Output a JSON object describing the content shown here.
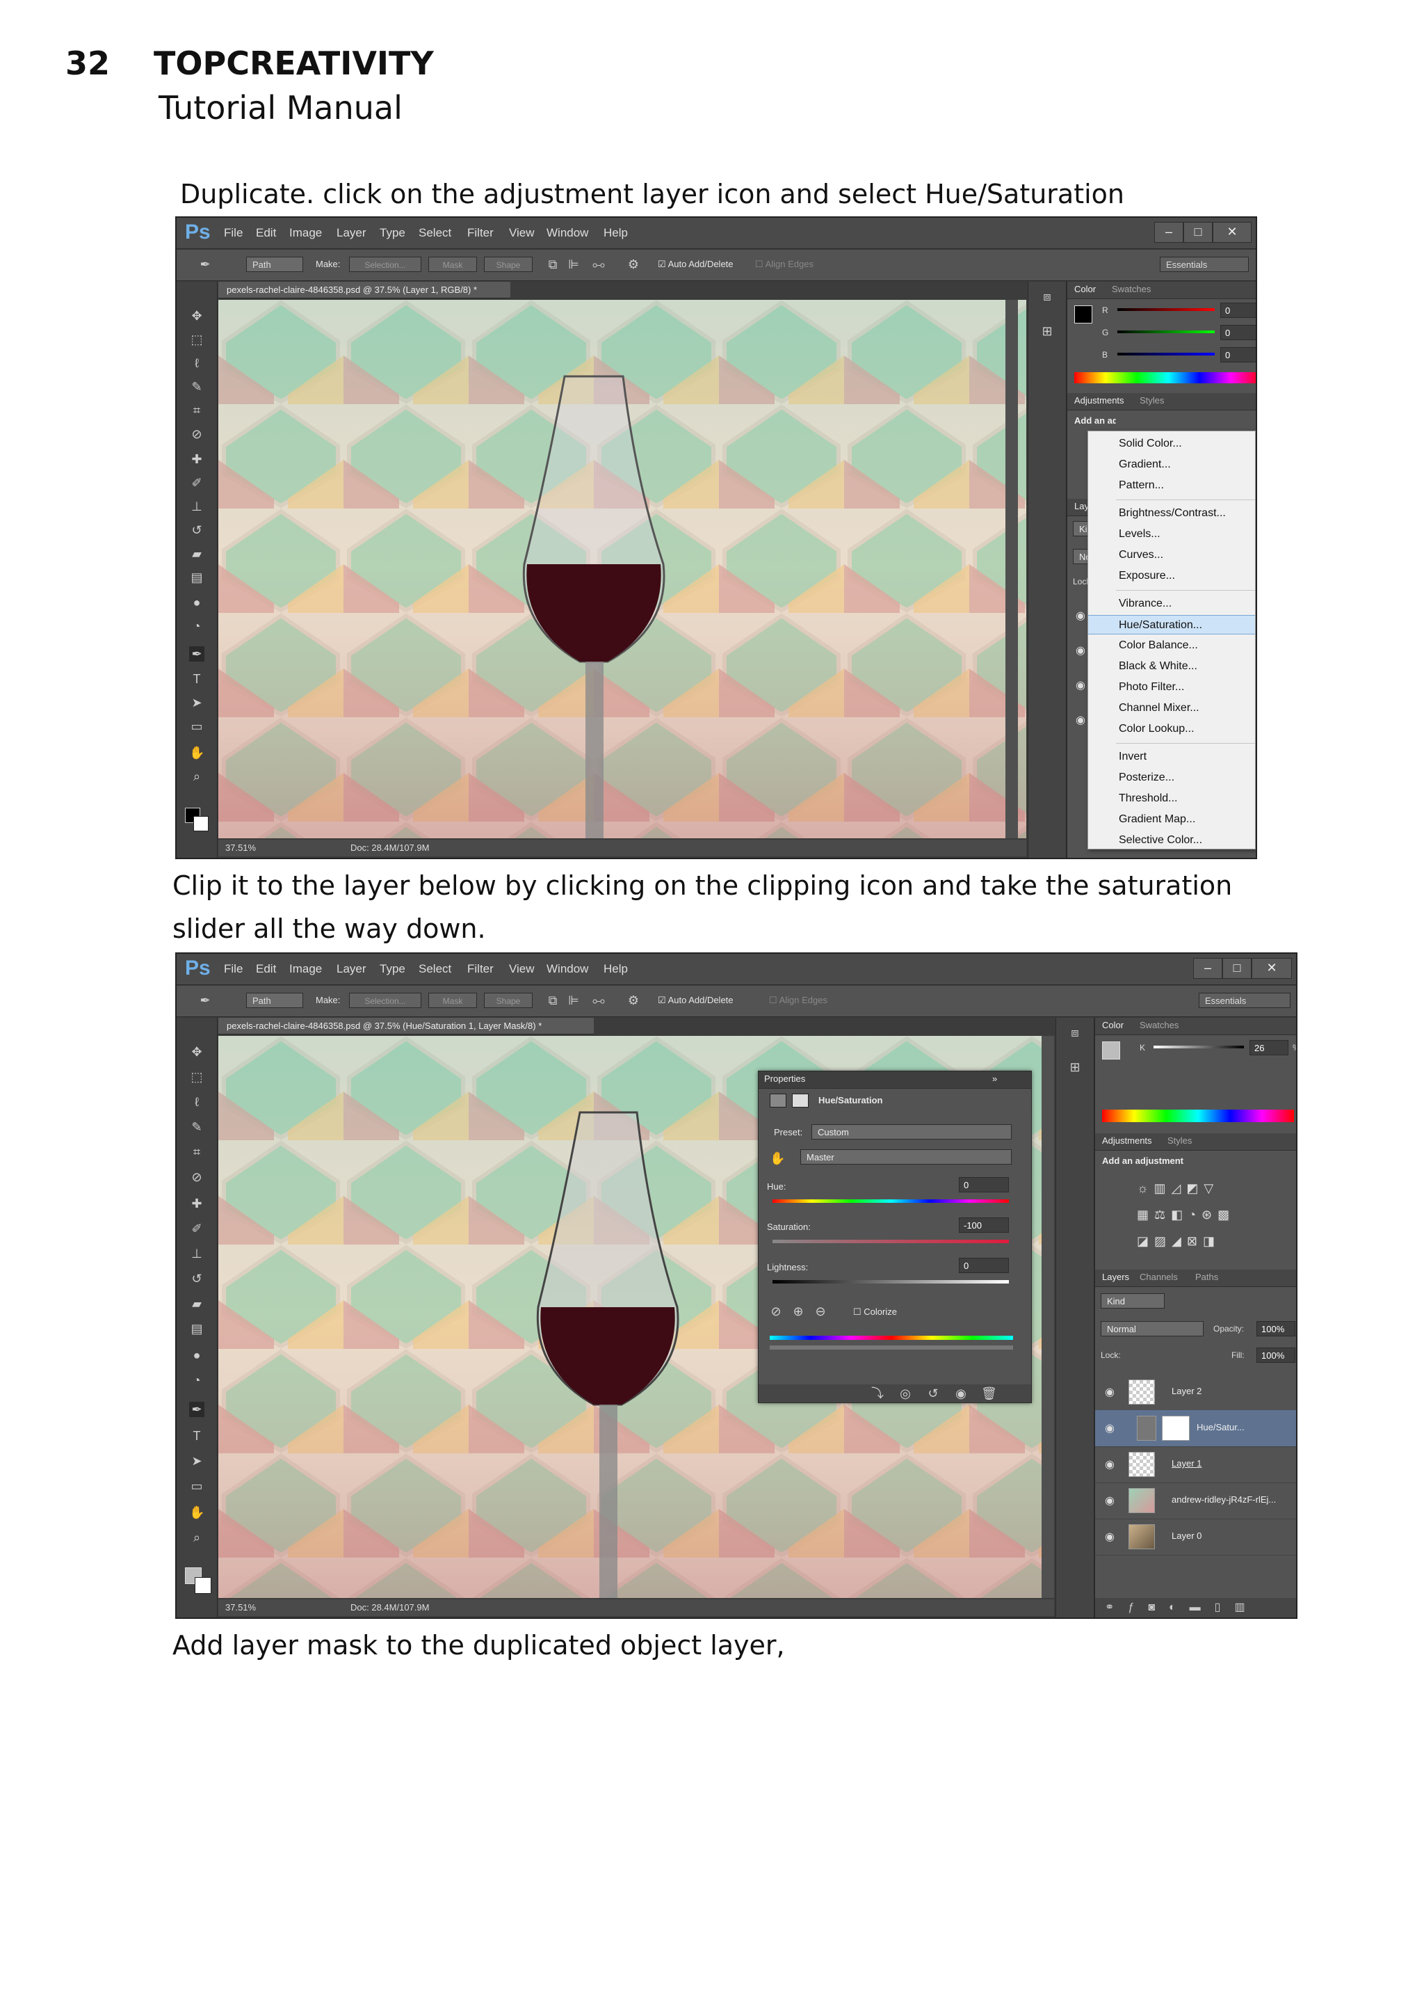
{
  "page": {
    "number": "32",
    "brand": "TOPCREATIVITY",
    "subtitle": "Tutorial Manual"
  },
  "text": {
    "step1": "Duplicate. click on the adjustment layer icon and select Hue/Saturation",
    "step2_line1": "Clip it to the layer below by clicking on the clipping icon and take the saturation",
    "step2_line2": "slider all the way down.",
    "step3": "Add layer mask to the duplicated object layer,"
  },
  "photoshop": {
    "logo": "Ps",
    "menu": [
      "File",
      "Edit",
      "Image",
      "Layer",
      "Type",
      "Select",
      "Filter",
      "View",
      "Window",
      "Help"
    ],
    "options": {
      "mode": "Path",
      "make_label": "Make:",
      "selection": "Selection...",
      "mask": "Mask",
      "shape": "Shape",
      "auto_add_delete": "Auto Add/Delete",
      "align_edges": "Align Edges",
      "workspace": "Essentials"
    },
    "shot1": {
      "doc_tab": "pexels-rachel-claire-4846358.psd @ 37.5% (Layer 1, RGB/8) *",
      "zoom": "37.51%",
      "doc_size": "Doc: 28.4M/107.9M",
      "color_tab": "Color",
      "swatches_tab": "Swatches",
      "rgb": [
        {
          "channel": "R",
          "value": "0"
        },
        {
          "channel": "G",
          "value": "0"
        },
        {
          "channel": "B",
          "value": "0"
        }
      ],
      "adjustments_tab": "Adjustments",
      "styles_tab": "Styles",
      "add_adjustment": "Add an adjustment",
      "layers_tab": "Layers",
      "kind": "Kind",
      "blend": "Normal",
      "lock": "Lock:",
      "context_menu": [
        {
          "label": "Solid Color...",
          "group": 1
        },
        {
          "label": "Gradient...",
          "group": 1
        },
        {
          "label": "Pattern...",
          "group": 1
        },
        {
          "label": "Brightness/Contrast...",
          "group": 2
        },
        {
          "label": "Levels...",
          "group": 2
        },
        {
          "label": "Curves...",
          "group": 2
        },
        {
          "label": "Exposure...",
          "group": 2
        },
        {
          "label": "Vibrance...",
          "group": 3
        },
        {
          "label": "Hue/Saturation...",
          "group": 3,
          "selected": true
        },
        {
          "label": "Color Balance...",
          "group": 3
        },
        {
          "label": "Black & White...",
          "group": 3
        },
        {
          "label": "Photo Filter...",
          "group": 3
        },
        {
          "label": "Channel Mixer...",
          "group": 3
        },
        {
          "label": "Color Lookup...",
          "group": 3
        },
        {
          "label": "Invert",
          "group": 4
        },
        {
          "label": "Posterize...",
          "group": 4
        },
        {
          "label": "Threshold...",
          "group": 4
        },
        {
          "label": "Gradient Map...",
          "group": 4
        },
        {
          "label": "Selective Color...",
          "group": 4
        }
      ]
    },
    "shot2": {
      "doc_tab": "pexels-rachel-claire-4846358.psd @ 37.5% (Hue/Saturation 1, Layer Mask/8) *",
      "zoom": "37.51%",
      "doc_size": "Doc: 28.4M/107.9M",
      "color_tab": "Color",
      "swatches_tab": "Swatches",
      "k_label": "K",
      "k_value": "26",
      "k_unit": "%",
      "adjustments_tab": "Adjustments",
      "styles_tab": "Styles",
      "add_adjustment": "Add an adjustment",
      "layers_tabs": [
        "Layers",
        "Channels",
        "Paths"
      ],
      "kind": "Kind",
      "blend": "Normal",
      "opacity_label": "Opacity:",
      "opacity": "100%",
      "lock": "Lock:",
      "fill_label": "Fill:",
      "fill": "100%",
      "layers": [
        {
          "name": "Layer 2"
        },
        {
          "name": "Hue/Satur..."
        },
        {
          "name": "Layer 1"
        },
        {
          "name": "andrew-ridley-jR4zF-rlEj..."
        },
        {
          "name": "Layer 0"
        }
      ],
      "properties": {
        "title": "Properties",
        "adjustment": "Hue/Saturation",
        "preset_label": "Preset:",
        "preset": "Custom",
        "channel": "Master",
        "hue_label": "Hue:",
        "hue": "0",
        "saturation_label": "Saturation:",
        "saturation": "-100",
        "lightness_label": "Lightness:",
        "lightness": "0",
        "colorize": "Colorize"
      }
    }
  }
}
